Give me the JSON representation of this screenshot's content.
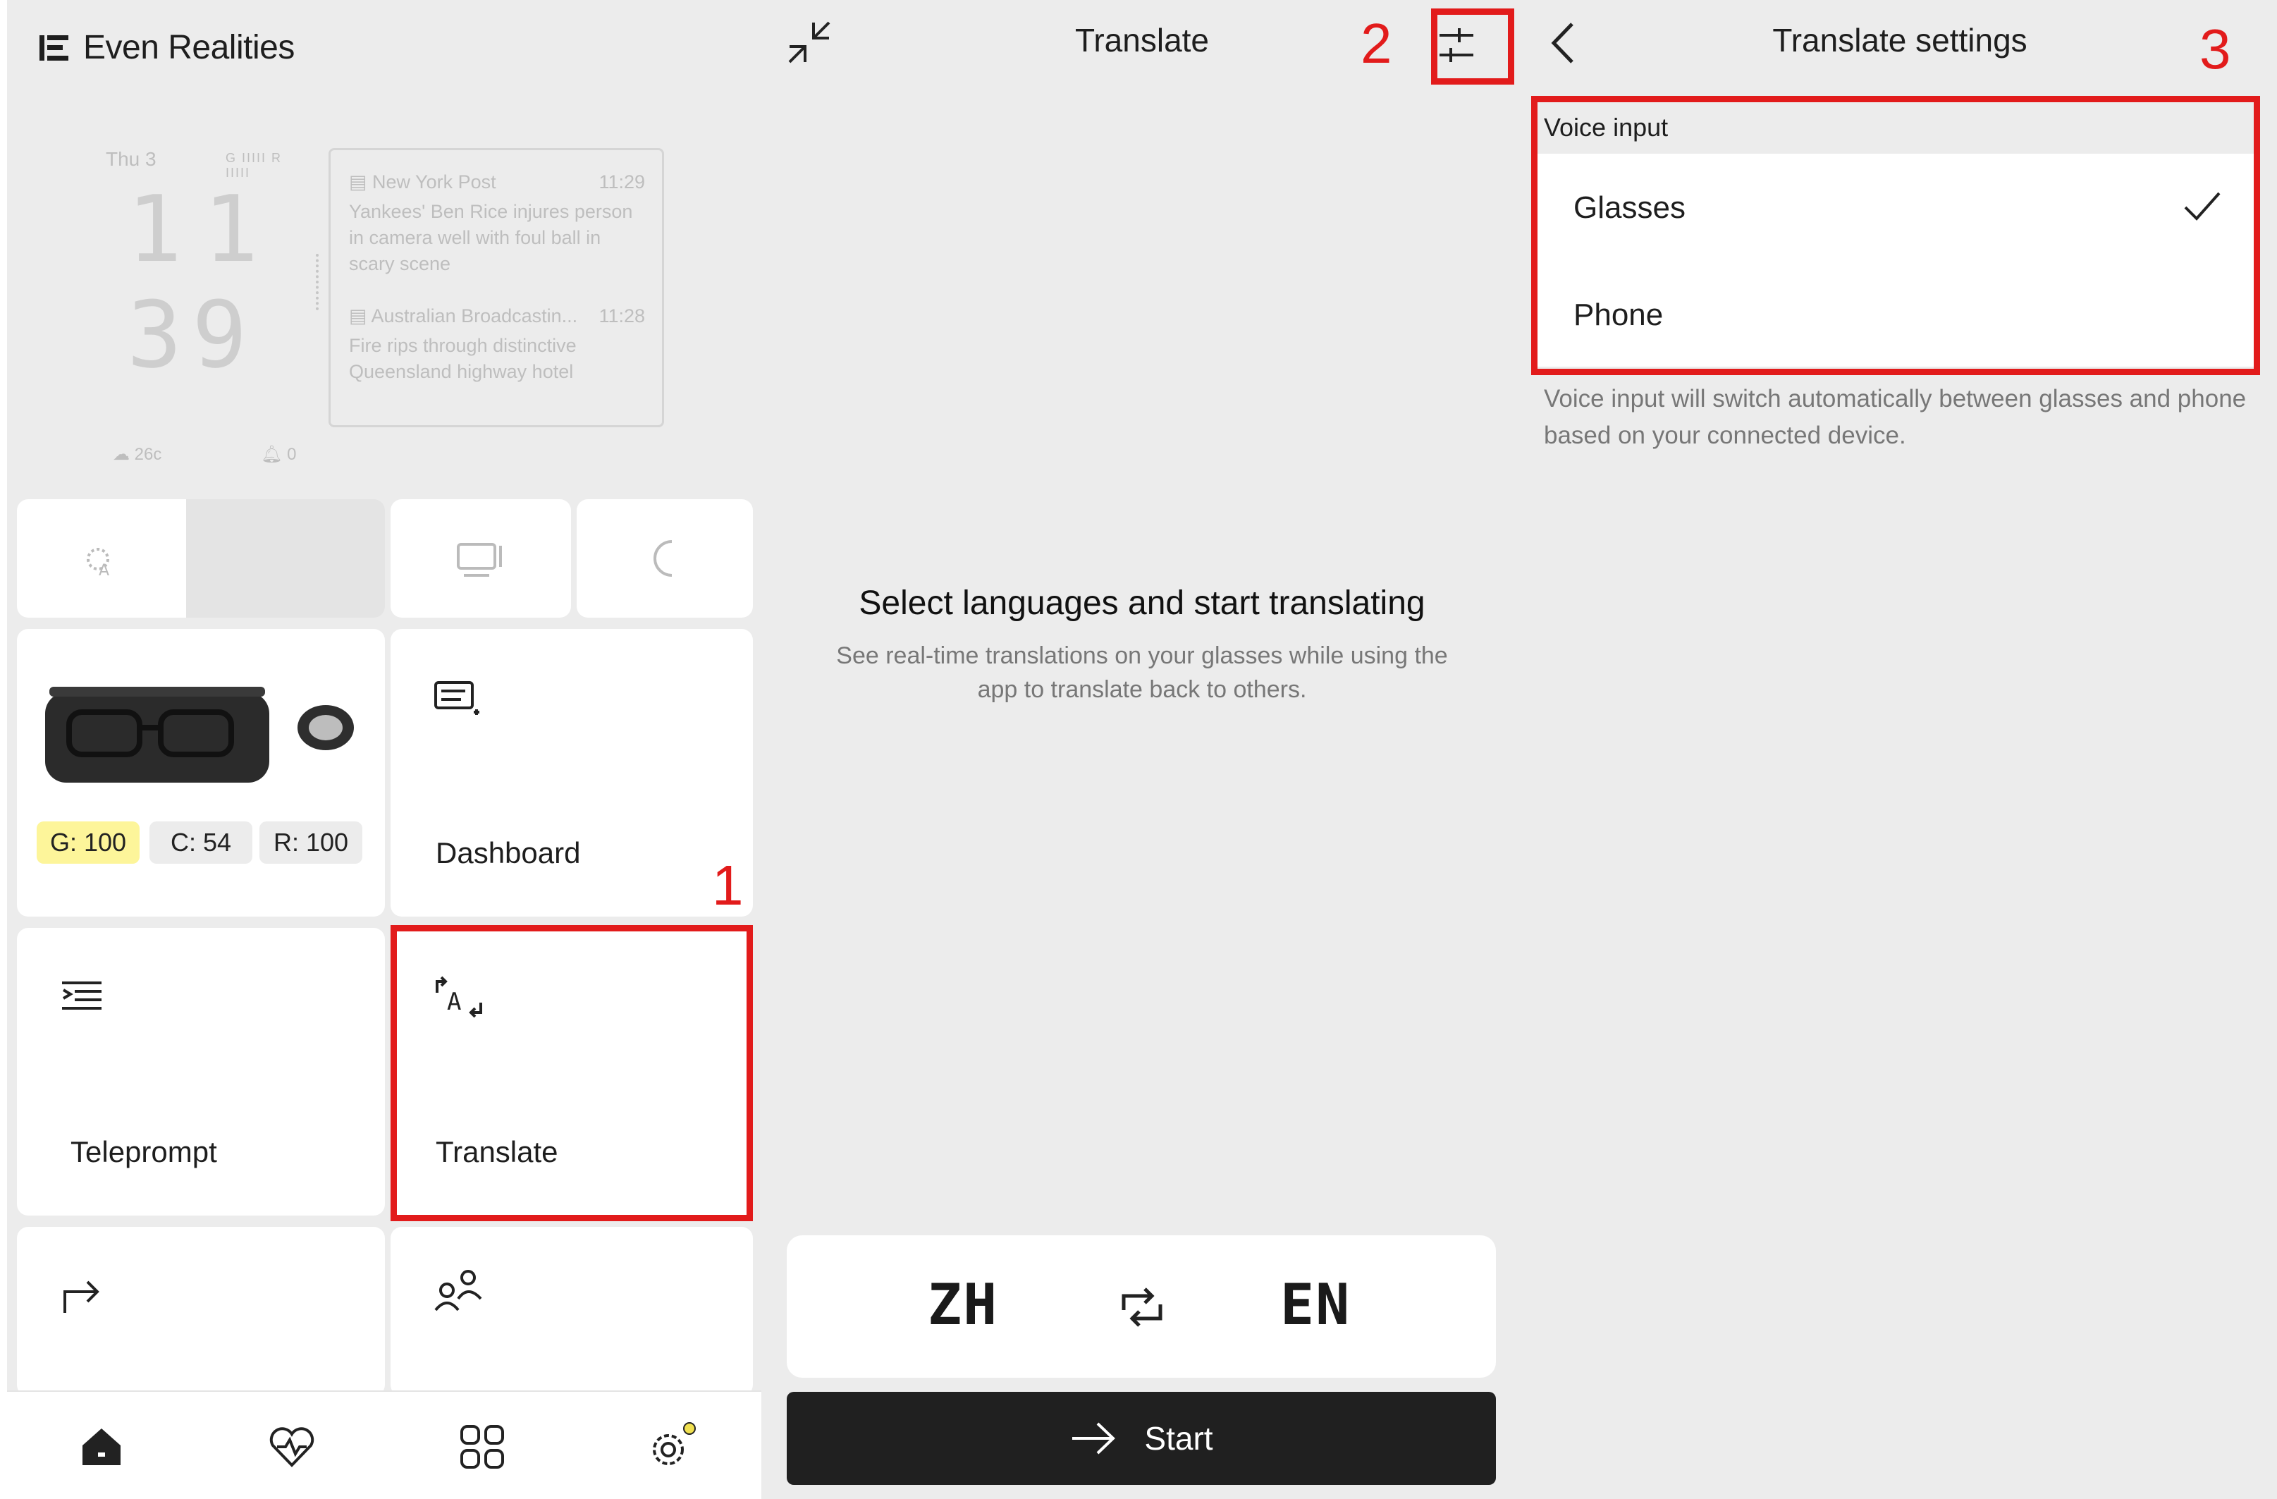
{
  "home": {
    "brand": "Even Realities",
    "clock": {
      "date": "Thu 3",
      "battery": "G IIIII R IIIII",
      "hours": "11",
      "minutes": "39",
      "weather": "26c",
      "notifications": "0"
    },
    "news": [
      {
        "source": "New York Post",
        "time": "11:29",
        "headline": "Yankees' Ben Rice injures person in camera well with foul ball in scary scene"
      },
      {
        "source": "Australian Broadcastin...",
        "time": "11:28",
        "headline": "Fire rips through distinctive Queensland highway hotel"
      }
    ],
    "device": {
      "glasses": "G: 100",
      "case": "C: 54",
      "ring": "R: 100"
    },
    "tiles": {
      "dashboard": "Dashboard",
      "teleprompt": "Teleprompt",
      "translate": "Translate"
    },
    "nav_icons": [
      "home-icon",
      "health-icon",
      "apps-icon",
      "settings-icon"
    ]
  },
  "translate": {
    "title": "Translate",
    "heading": "Select languages and start translating",
    "subtitle": "See real-time translations on your glasses while using the app to translate back to others.",
    "source_lang": "ZH",
    "target_lang": "EN",
    "start_label": "Start"
  },
  "settings": {
    "title": "Translate settings",
    "section": "Voice input",
    "options": [
      {
        "label": "Glasses",
        "selected": true
      },
      {
        "label": "Phone",
        "selected": false
      }
    ],
    "helper": "Voice input will switch automatically between glasses and phone based on your connected device."
  },
  "annotations": {
    "step1": "1",
    "step2": "2",
    "step3": "3",
    "highlight_color": "#e21b1b"
  }
}
